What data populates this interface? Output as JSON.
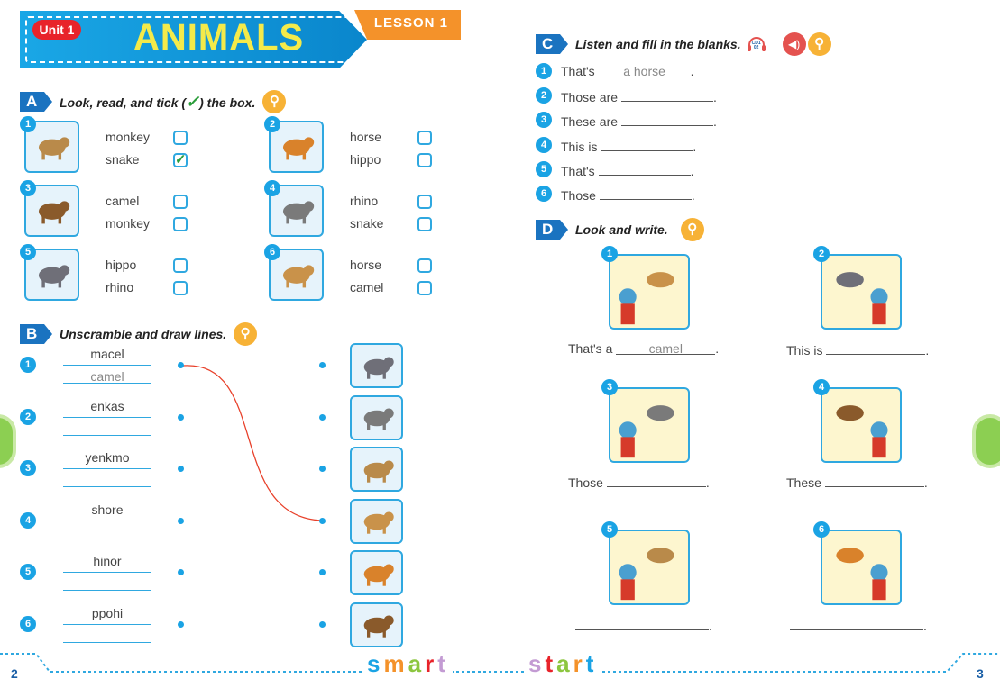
{
  "header": {
    "unit": "Unit 1",
    "title": "ANIMALS",
    "lesson": "LESSON 1"
  },
  "sectionA": {
    "letter": "A",
    "instruction_pre": "Look, read, and tick (",
    "instruction_post": ") the box.",
    "check_icon": "check-icon",
    "items": [
      {
        "n": "1",
        "animal": "snake",
        "options": [
          {
            "label": "monkey",
            "checked": false
          },
          {
            "label": "snake",
            "checked": true
          }
        ]
      },
      {
        "n": "2",
        "animal": "horse",
        "options": [
          {
            "label": "horse",
            "checked": false
          },
          {
            "label": "hippo",
            "checked": false
          }
        ]
      },
      {
        "n": "3",
        "animal": "monkey",
        "options": [
          {
            "label": "camel",
            "checked": false
          },
          {
            "label": "monkey",
            "checked": false
          }
        ]
      },
      {
        "n": "4",
        "animal": "rhino",
        "options": [
          {
            "label": "rhino",
            "checked": false
          },
          {
            "label": "snake",
            "checked": false
          }
        ]
      },
      {
        "n": "5",
        "animal": "hippo",
        "options": [
          {
            "label": "hippo",
            "checked": false
          },
          {
            "label": "rhino",
            "checked": false
          }
        ]
      },
      {
        "n": "6",
        "animal": "camel",
        "options": [
          {
            "label": "horse",
            "checked": false
          },
          {
            "label": "camel",
            "checked": false
          }
        ]
      }
    ]
  },
  "sectionB": {
    "letter": "B",
    "instruction": "Unscramble and draw lines.",
    "items": [
      {
        "n": "1",
        "scrambled": "macel",
        "answer": "camel"
      },
      {
        "n": "2",
        "scrambled": "enkas",
        "answer": ""
      },
      {
        "n": "3",
        "scrambled": "yenkmo",
        "answer": ""
      },
      {
        "n": "4",
        "scrambled": "shore",
        "answer": ""
      },
      {
        "n": "5",
        "scrambled": "hinor",
        "answer": ""
      },
      {
        "n": "6",
        "scrambled": "ppohi",
        "answer": ""
      }
    ],
    "pictures": [
      "hippo",
      "rhino",
      "snake",
      "camel",
      "horse",
      "monkey"
    ],
    "line_color": "#e8402a"
  },
  "sectionC": {
    "letter": "C",
    "instruction": "Listen and fill in the blanks.",
    "track": "CD1 02",
    "items": [
      {
        "n": "1",
        "prefix": "That's",
        "answer": "a horse"
      },
      {
        "n": "2",
        "prefix": "Those are",
        "answer": ""
      },
      {
        "n": "3",
        "prefix": "These are",
        "answer": ""
      },
      {
        "n": "4",
        "prefix": "This is",
        "answer": ""
      },
      {
        "n": "5",
        "prefix": "That's",
        "answer": ""
      },
      {
        "n": "6",
        "prefix": "Those",
        "answer": ""
      }
    ]
  },
  "sectionD": {
    "letter": "D",
    "instruction": "Look and write.",
    "items": [
      {
        "n": "1",
        "prefix": "That's a",
        "answer": "camel",
        "scene": "camel"
      },
      {
        "n": "2",
        "prefix": "This is",
        "answer": "",
        "scene": "hippo"
      },
      {
        "n": "3",
        "prefix": "Those",
        "answer": "",
        "scene": "rhinos"
      },
      {
        "n": "4",
        "prefix": "These",
        "answer": "",
        "scene": "monkeys"
      },
      {
        "n": "5",
        "prefix": "",
        "answer": "",
        "scene": "snakes"
      },
      {
        "n": "6",
        "prefix": "",
        "answer": "",
        "scene": "horses"
      }
    ]
  },
  "footer": {
    "left_page": "2",
    "right_page": "3",
    "brand1": "smart",
    "brand2": "start"
  },
  "colors": {
    "primary": "#1aa3e4",
    "banner": "#0a86cc",
    "title": "#f4ea4a",
    "lesson": "#f4922a",
    "unit": "#e8232a",
    "key": "#f7b236"
  }
}
